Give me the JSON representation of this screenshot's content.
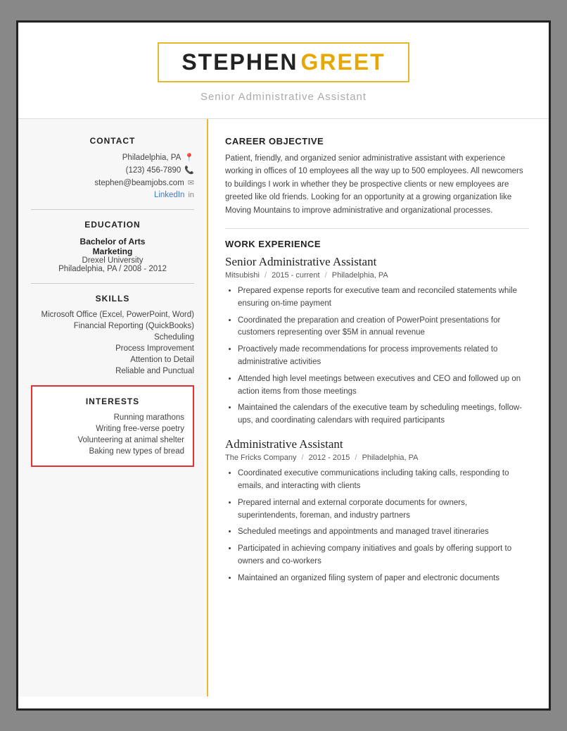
{
  "header": {
    "name_first": "STEPHEN",
    "name_last": "GREET",
    "subtitle": "Senior Administrative Assistant"
  },
  "left": {
    "sections": {
      "contact": {
        "label": "CONTACT",
        "location": "Philadelphia, PA",
        "phone": "(123) 456-7890",
        "email": "stephen@beamjobs.com",
        "linkedin_label": "LinkedIn"
      },
      "education": {
        "label": "EDUCATION",
        "degree": "Bachelor of Arts",
        "major": "Marketing",
        "school": "Drexel University",
        "location_year": "Philadelphia, PA  /  2008 - 2012"
      },
      "skills": {
        "label": "SKILLS",
        "items": [
          "Microsoft Office (Excel, PowerPoint, Word)",
          "Financial Reporting (QuickBooks)",
          "Scheduling",
          "Process Improvement",
          "Attention to Detail",
          "Reliable and Punctual"
        ]
      },
      "interests": {
        "label": "INTERESTS",
        "items": [
          "Running marathons",
          "Writing free-verse poetry",
          "Volunteering at animal shelter",
          "Baking new types of bread"
        ]
      }
    }
  },
  "right": {
    "career_objective": {
      "label": "CAREER OBJECTIVE",
      "text": "Patient, friendly, and organized senior administrative assistant with experience working in offices of 10 employees all the way up to 500 employees. All newcomers to buildings I work in whether they be prospective clients or new employees are greeted like old friends. Looking for an opportunity at a growing organization like Moving Mountains to improve administrative and organizational processes."
    },
    "work_experience": {
      "label": "WORK EXPERIENCE",
      "jobs": [
        {
          "title": "Senior Administrative Assistant",
          "company": "Mitsubishi",
          "period": "2015 - current",
          "location": "Philadelphia, PA",
          "bullets": [
            "Prepared expense reports for executive team and reconciled statements while ensuring on-time payment",
            "Coordinated the preparation and creation of PowerPoint presentations for customers representing over $5M in annual revenue",
            "Proactively made recommendations for process improvements related to administrative activities",
            "Attended high level meetings between executives and CEO and followed up on action items from those meetings",
            "Maintained the calendars of the executive team by scheduling meetings, follow-ups, and coordinating calendars with required participants"
          ]
        },
        {
          "title": "Administrative Assistant",
          "company": "The Fricks Company",
          "period": "2012 - 2015",
          "location": "Philadelphia, PA",
          "bullets": [
            "Coordinated executive communications including taking calls, responding to emails, and interacting with clients",
            "Prepared internal and external corporate documents for owners, superintendents, foreman, and industry partners",
            "Scheduled meetings and appointments and managed travel itineraries",
            "Participated in achieving company initiatives and goals by offering support to owners and co-workers",
            "Maintained an organized filing system of paper and electronic documents"
          ]
        }
      ]
    }
  }
}
